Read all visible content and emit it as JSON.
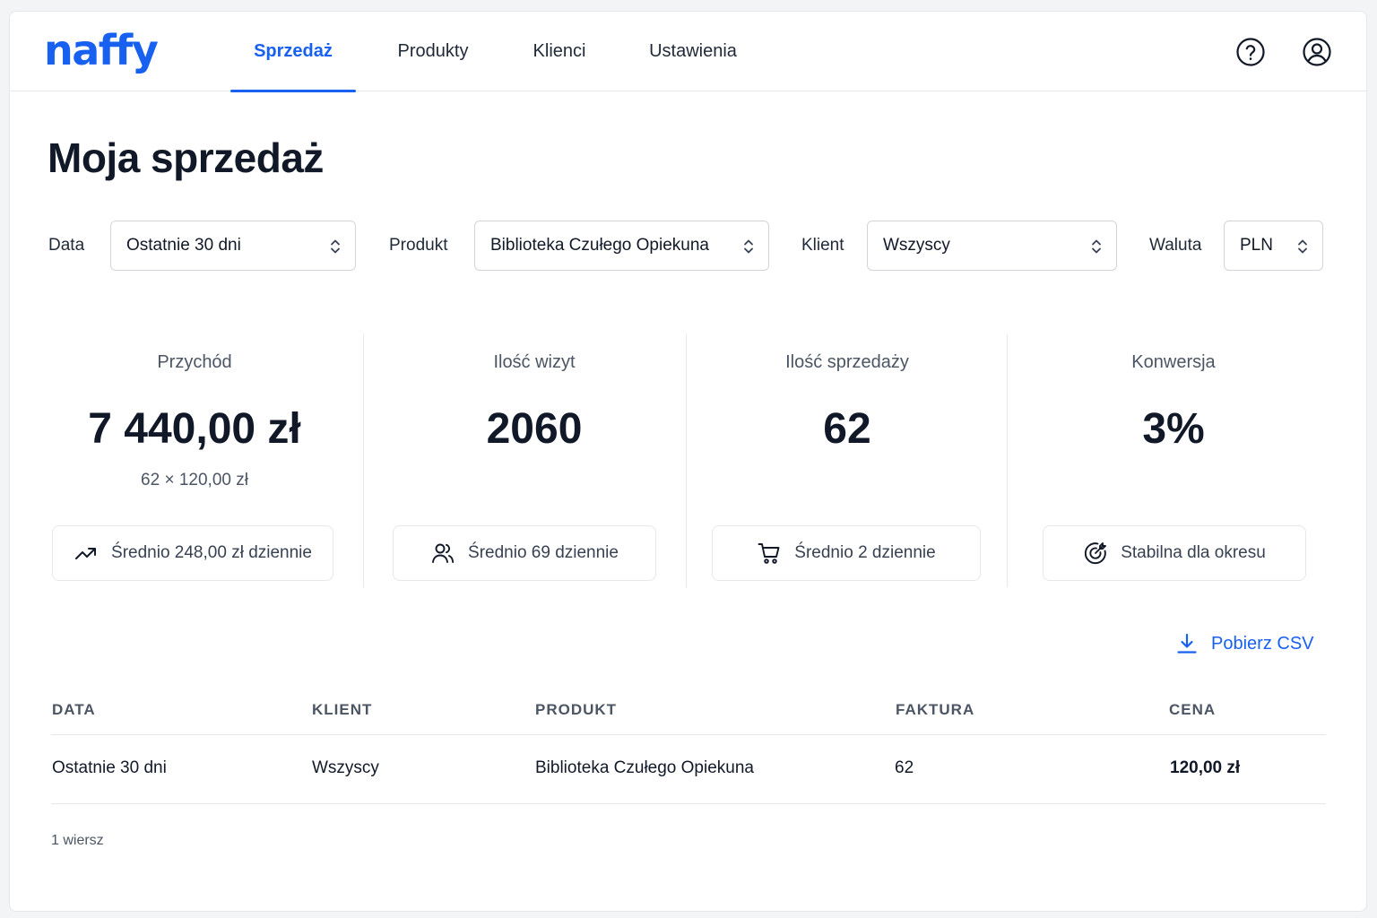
{
  "app": {
    "logo": "naffy"
  },
  "nav": {
    "tabs": [
      {
        "label": "Sprzedaż",
        "active": true
      },
      {
        "label": "Produkty",
        "active": false
      },
      {
        "label": "Klienci",
        "active": false
      },
      {
        "label": "Ustawienia",
        "active": false
      }
    ],
    "icons": [
      "help-icon",
      "user-icon"
    ]
  },
  "page": {
    "title": "Moja sprzedaż"
  },
  "filters": {
    "date": {
      "label": "Data",
      "value": "Ostatnie 30 dni"
    },
    "product": {
      "label": "Produkt",
      "value": "Biblioteka Czułego Opiekuna"
    },
    "client": {
      "label": "Klient",
      "value": "Wszyscy"
    },
    "currency": {
      "label": "Waluta",
      "value": "PLN"
    }
  },
  "metrics": {
    "revenue": {
      "label": "Przychód",
      "value": "7 440,00 zł",
      "sub": "62 × 120,00 zł",
      "note": "Średnio 248,00 zł dziennie",
      "icon": "trend-up-icon"
    },
    "visits": {
      "label": "Ilość wizyt",
      "value": "2060",
      "note": "Średnio 69 dziennie",
      "icon": "users-icon"
    },
    "sales": {
      "label": "Ilość sprzedaży",
      "value": "62",
      "note": "Średnio 2 dziennie",
      "icon": "cart-icon"
    },
    "conversion": {
      "label": "Konwersja",
      "value": "3%",
      "note": "Stabilna dla okresu",
      "icon": "target-icon"
    }
  },
  "csv": {
    "label": "Pobierz CSV",
    "icon": "download-icon"
  },
  "table": {
    "columns": [
      "DATA",
      "KLIENT",
      "PRODUKT",
      "FAKTURA",
      "CENA"
    ],
    "rows": [
      [
        "Ostatnie 30 dni",
        "Wszyscy",
        "Biblioteka Czułego Opiekuna",
        "62",
        "120,00 zł"
      ]
    ],
    "row_count": "1 wiersz"
  },
  "colors": {
    "accent": "#1760f0",
    "text": "#111827",
    "muted": "#4b5563",
    "border": "#e5e7eb"
  }
}
